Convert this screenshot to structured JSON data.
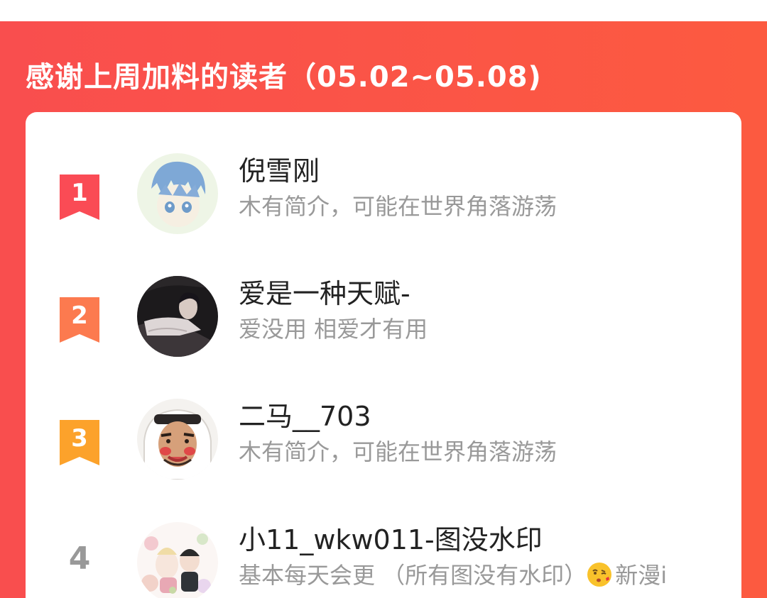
{
  "header": {
    "title": "感谢上周加料的读者（05.02~05.08)"
  },
  "readers": [
    {
      "rank": "1",
      "name": "倪雪刚",
      "bio": "木有简介，可能在世界角落游荡",
      "badge_color": "#fa4b55"
    },
    {
      "rank": "2",
      "name": "爱是一种天赋-",
      "bio": "爱没用 相爱才有用",
      "badge_color": "#fc7a4f"
    },
    {
      "rank": "3",
      "name": "二马__703",
      "bio": "木有简介，可能在世界角落游荡",
      "badge_color": "#fca22b"
    },
    {
      "rank": "4",
      "name": "小11_wkw011-图没水印",
      "bio": "基本每天会更 （所有图没有水印）",
      "bio_tail": "新漫i"
    }
  ],
  "icons": {
    "emoji": "kissing-face-emoji"
  }
}
